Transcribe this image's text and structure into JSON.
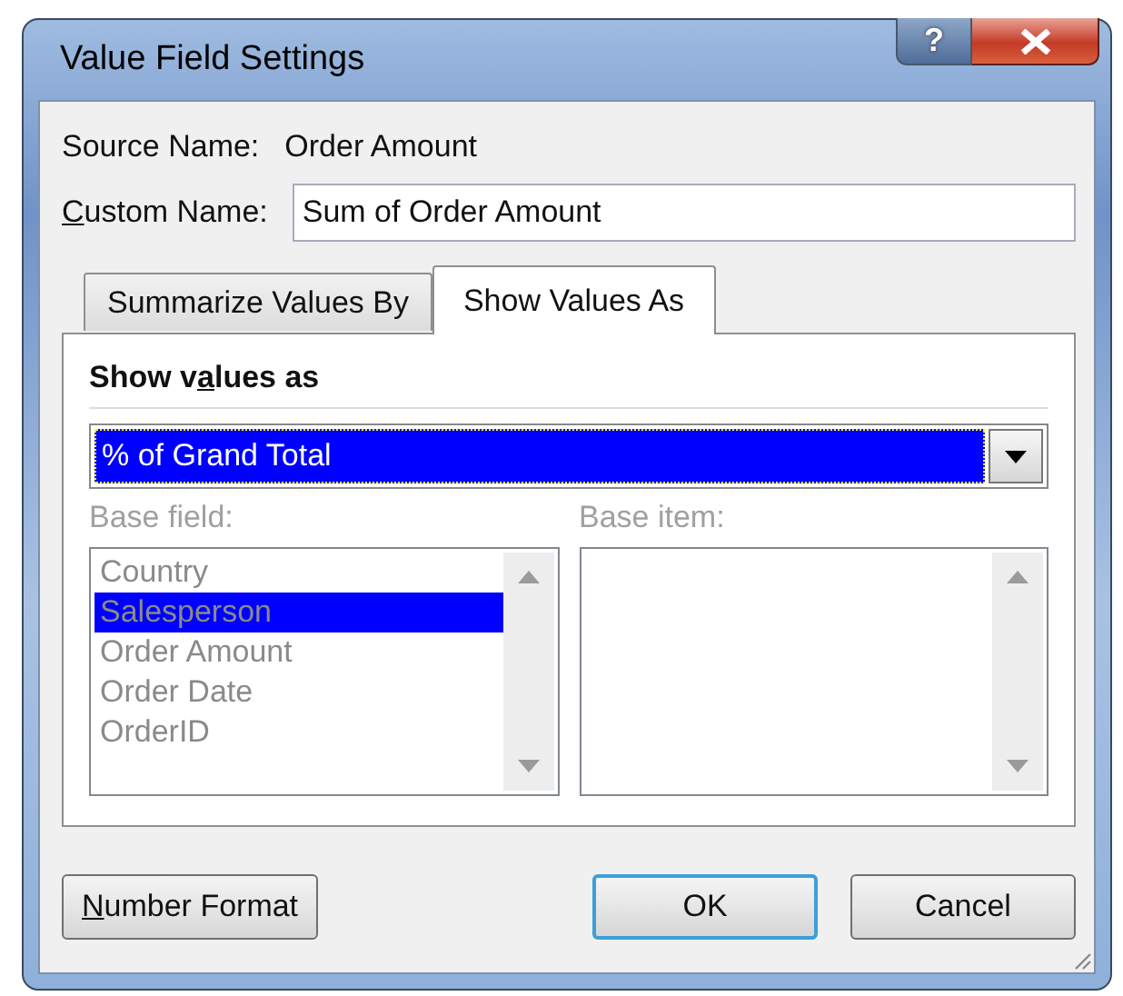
{
  "window": {
    "title": "Value Field Settings",
    "help_button": "?"
  },
  "source_name": {
    "label": "Source Name:",
    "value": "Order Amount"
  },
  "custom_name": {
    "label_parts": [
      {
        "text": "C",
        "underline": true
      },
      {
        "text": "ustom Name:",
        "underline": false
      }
    ],
    "value": "Sum of Order Amount"
  },
  "tabs": [
    {
      "label": "Summarize Values By",
      "selected": false
    },
    {
      "label": "Show Values As",
      "selected": true
    }
  ],
  "section": {
    "heading_parts": [
      {
        "text": "Show v",
        "underline": false
      },
      {
        "text": "a",
        "underline": true
      },
      {
        "text": "lues as",
        "underline": false
      }
    ]
  },
  "show_values_dropdown": {
    "value": "% of Grand Total"
  },
  "base_field": {
    "label": "Base field:",
    "disabled": true,
    "items": [
      {
        "label": "Country",
        "selected": false
      },
      {
        "label": "Salesperson",
        "selected": true
      },
      {
        "label": "Order Amount",
        "selected": false
      },
      {
        "label": "Order Date",
        "selected": false
      },
      {
        "label": "OrderID",
        "selected": false
      }
    ]
  },
  "base_item": {
    "label": "Base item:",
    "disabled": true
  },
  "number_format_button": {
    "label_parts": [
      {
        "text": "N",
        "underline": true
      },
      {
        "text": "umber Format",
        "underline": false
      }
    ]
  },
  "buttons": [
    {
      "label": "OK",
      "default": true
    },
    {
      "label": "Cancel",
      "default": false
    }
  ]
}
